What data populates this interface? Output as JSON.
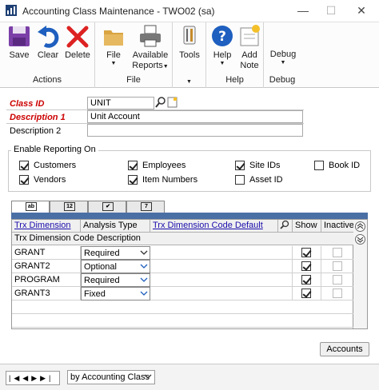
{
  "window": {
    "title": "Accounting Class Maintenance  -  TWO02 (sa)",
    "min_icon": "minimize-icon",
    "max_icon": "maximize-icon",
    "close_icon": "close-icon"
  },
  "ribbon": {
    "groups": [
      {
        "name": "Actions",
        "buttons": [
          {
            "label": "Save",
            "icon": "save-icon"
          },
          {
            "label": "Clear",
            "icon": "undo-icon"
          },
          {
            "label": "Delete",
            "icon": "delete-x-icon"
          }
        ]
      },
      {
        "name": "File",
        "buttons": [
          {
            "label": "File",
            "icon": "folder-icon"
          },
          {
            "label": "Available Reports",
            "label1": "Available",
            "label2": "Reports",
            "icon": "printer-icon"
          }
        ]
      },
      {
        "name": "",
        "buttons": [
          {
            "label": "Tools",
            "icon": "tools-icon"
          }
        ]
      },
      {
        "name": "Help",
        "buttons": [
          {
            "label": "Help",
            "icon": "help-icon"
          },
          {
            "label": "Add Note",
            "label1": "Add",
            "label2": "Note",
            "icon": "note-icon"
          }
        ]
      },
      {
        "name": "Debug",
        "buttons": [
          {
            "label": "Debug",
            "icon": "debug-icon"
          }
        ]
      }
    ]
  },
  "form": {
    "class_id_label": "Class ID",
    "class_id_value": "UNIT",
    "description1_label": "Description 1",
    "description1_value": "Unit Account",
    "description2_label": "Description 2",
    "description2_value": ""
  },
  "reporting": {
    "title": "Enable Reporting On",
    "options": [
      {
        "label": "Customers",
        "checked": true
      },
      {
        "label": "Vendors",
        "checked": true
      },
      {
        "label": "Employees",
        "checked": true
      },
      {
        "label": "Item Numbers",
        "checked": true
      },
      {
        "label": "Site IDs",
        "checked": true
      },
      {
        "label": "Asset ID",
        "checked": false
      },
      {
        "label": "Book ID",
        "checked": false
      }
    ]
  },
  "tabs": [
    {
      "icon": "ab-text-icon",
      "glyph": "ab"
    },
    {
      "icon": "numeric-12-icon",
      "glyph": "12"
    },
    {
      "icon": "checkbox-icon",
      "glyph": "✔"
    },
    {
      "icon": "date-icon",
      "glyph": "7"
    }
  ],
  "grid": {
    "headers": {
      "trx_dimension": "Trx Dimension",
      "analysis_type": "Analysis Type",
      "code_default": "Trx Dimension Code Default",
      "show": "Show",
      "inactive": "Inactive",
      "code_description": "Trx Dimension Code Description"
    },
    "rows": [
      {
        "dimension": "GRANT",
        "analysis_type": "Required",
        "code_default": "",
        "show": true,
        "inactive": false
      },
      {
        "dimension": "GRANT2",
        "analysis_type": "Optional",
        "code_default": "",
        "show": true,
        "inactive": false
      },
      {
        "dimension": "PROGRAM",
        "analysis_type": "Required",
        "code_default": "",
        "show": true,
        "inactive": false
      },
      {
        "dimension": "GRANT3",
        "analysis_type": "Fixed",
        "code_default": "",
        "show": true,
        "inactive": false
      }
    ]
  },
  "buttons": {
    "accounts": "Accounts"
  },
  "statusbar": {
    "sort_select": "by Accounting Class"
  },
  "colors": {
    "required_label": "#cc0000",
    "link": "#1a0dab",
    "help_icon": "#1e5fbf"
  }
}
